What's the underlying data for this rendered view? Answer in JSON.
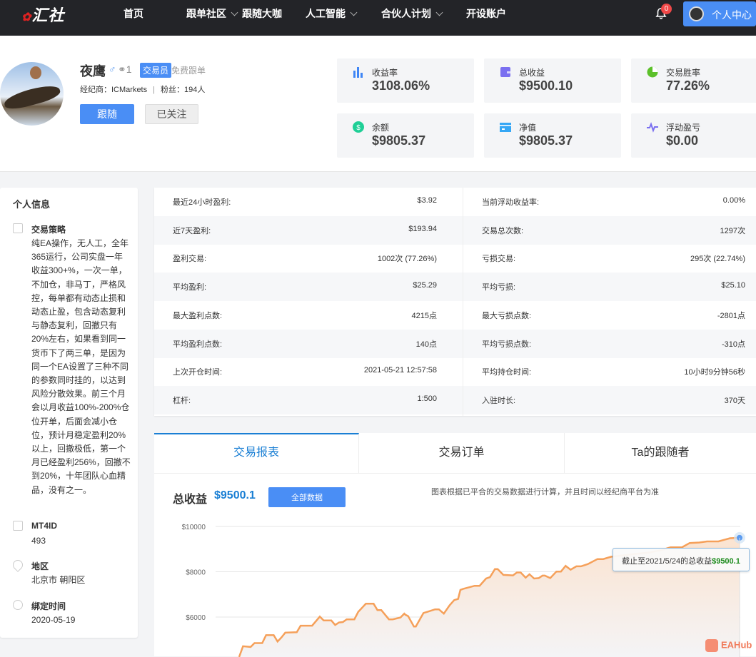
{
  "nav": {
    "logo": "汇声汇社",
    "items": [
      {
        "label": "首页"
      },
      {
        "label": "跟单社区"
      },
      {
        "label": "跟随大咖"
      },
      {
        "label": "人工智能"
      },
      {
        "label": "合伙人计划"
      },
      {
        "label": "开设账户"
      }
    ],
    "notifications": "0",
    "user_center": "个人中心"
  },
  "profile": {
    "name": "夜鹰",
    "level": "1",
    "tag": "交易员",
    "free": "免费跟单",
    "broker": "经纪商：ICMarkets",
    "fans": "粉丝：194人",
    "follow": "跟随",
    "followed": "已关注"
  },
  "cards": [
    {
      "label": "收益率",
      "value": "3108.06%",
      "icon": "bar-chart-icon",
      "color": "#3f86f5"
    },
    {
      "label": "总收益",
      "value": "$9500.10",
      "icon": "wallet-icon",
      "color": "#7a6ff0"
    },
    {
      "label": "交易胜率",
      "value": "77.26%",
      "icon": "pie-chart-icon",
      "color": "#5cc02a"
    },
    {
      "label": "余额",
      "value": "$9805.37",
      "icon": "dollar-icon",
      "color": "#1fcf96"
    },
    {
      "label": "净值",
      "value": "$9805.37",
      "icon": "card-icon",
      "color": "#35a7f5"
    },
    {
      "label": "浮动盈亏",
      "value": "$0.00",
      "icon": "pulse-icon",
      "color": "#7a6ff0"
    }
  ],
  "info": {
    "title": "个人信息",
    "strategy_label": "交易策略",
    "strategy": "纯EA操作，无人工，全年365运行，公司实盘一年收益300+%，一次一单，不加仓，非马丁，严格风控，每单都有动态止损和动态止盈，包含动态复利与静态复利，回撤只有20%左右，如果看到同一货币下了两三单，是因为同一个EA设置了三种不同的参数同时挂的，以达到风险分散效果。前三个月会以月收益100%-200%仓位开单，后面会减小仓位，预计月稳定盈利20%以上，回撤极低，第一个月已经盈利256%，回撤不到20%，十年团队心血精品，没有之一。",
    "mt4_label": "MT4ID",
    "mt4": "493",
    "region_label": "地区",
    "region": "北京市 朝阳区",
    "bind_label": "绑定时间",
    "bind": "2020-05-19"
  },
  "stats": [
    [
      "最近24小时盈利:",
      "$3.92",
      "当前浮动收益率:",
      "0.00%"
    ],
    [
      "近7天盈利:",
      "$193.94",
      "交易总次数:",
      "1297次"
    ],
    [
      "盈利交易:",
      "1002次 (77.26%)",
      "亏损交易:",
      "295次 (22.74%)"
    ],
    [
      "平均盈利:",
      "$25.29",
      "平均亏损:",
      "$25.10"
    ],
    [
      "最大盈利点数:",
      "4215点",
      "最大亏损点数:",
      "-2801点"
    ],
    [
      "平均盈利点数:",
      "140点",
      "平均亏损点数:",
      "-310点"
    ],
    [
      "上次开仓时间:",
      "2021-05-21 12:57:58",
      "平均持仓时间:",
      "10小时9分钟56秒"
    ],
    [
      "杠杆:",
      "1:500",
      "入驻时长:",
      "370天"
    ]
  ],
  "tabs": [
    {
      "label": "交易报表"
    },
    {
      "label": "交易订单"
    },
    {
      "label": "Ta的跟随者"
    }
  ],
  "chart": {
    "title": "总收益",
    "value": "$9500.1",
    "all_button": "全部数据",
    "note": "图表根据已平合的交易数据进行计算，并且时间以经纪商平台为准",
    "tooltip_prefix": "截止至2021/5/24的总收益",
    "tooltip_value": "$9500.1",
    "watermark": "EAHub"
  },
  "chart_data": {
    "type": "area",
    "title": "总收益",
    "xlabel": "",
    "ylabel": "",
    "yticks": [
      "$10000",
      "$8000",
      "$6000"
    ],
    "ytick_values": [
      10000,
      8000,
      6000
    ],
    "ylim_visible": [
      4240,
      10000
    ],
    "color": "#f5a05a",
    "x": [
      0,
      1,
      3,
      4,
      6,
      7,
      9,
      10,
      11,
      12,
      15,
      16,
      19,
      21,
      22,
      24,
      25,
      26,
      27,
      28,
      30,
      31,
      33,
      35,
      36,
      37,
      39,
      40,
      42,
      43,
      43.3,
      44,
      45.5,
      46,
      48,
      49,
      51,
      52,
      53.3,
      54.8,
      56,
      57,
      57.6,
      58.3,
      61.3,
      62.6,
      64.3,
      65.3,
      66.6,
      67.3,
      68.8,
      71.3,
      72.3,
      73.3,
      74.6,
      75.6,
      76.8,
      78,
      79,
      79.6,
      81,
      82.6,
      83.8,
      85,
      86.3,
      87.8,
      89,
      90.8,
      93.3,
      94.8,
      96.8,
      103.8,
      106.8,
      109.8,
      112.3,
      115.3,
      117.3,
      119.8,
      121.8,
      124.8,
      125.8,
      127.8,
      130.3
    ],
    "y": [
      4240,
      4712,
      4680,
      4850,
      4850,
      5200,
      5200,
      4920,
      5100,
      5310,
      5330,
      5620,
      5620,
      6020,
      5850,
      5850,
      5650,
      5760,
      5780,
      5900,
      5900,
      6230,
      6590,
      6590,
      6310,
      6310,
      5900,
      5900,
      5980,
      6150,
      6100,
      6040,
      5580,
      5580,
      6180,
      6230,
      6340,
      6340,
      6150,
      6520,
      6750,
      6800,
      7200,
      7240,
      7380,
      7380,
      7700,
      7760,
      8115,
      8115,
      7860,
      7840,
      7970,
      7970,
      7740,
      7890,
      7700,
      7720,
      7830,
      7830,
      7720,
      8010,
      8010,
      8260,
      8090,
      8240,
      8240,
      8340,
      8560,
      8560,
      8660,
      8800,
      8850,
      8950,
      9080,
      9080,
      9270,
      9290,
      9340,
      9340,
      9390,
      9480,
      9500
    ]
  }
}
